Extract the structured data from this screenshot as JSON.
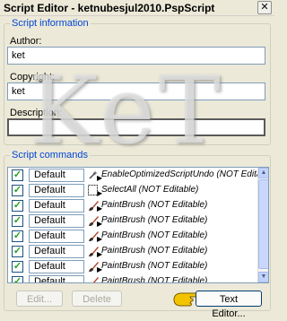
{
  "window": {
    "title": "Script Editor - ketnubesjul2010.PspScript",
    "close_glyph": "✕"
  },
  "script_info": {
    "legend": "Script information",
    "author_label": "Author:",
    "author_value": "ket",
    "copyright_label": "Copyright:",
    "copyright_value": "ket",
    "description_label": "Description:",
    "description_value": ""
  },
  "watermark": "KeT",
  "commands": {
    "legend": "Script commands",
    "rows": [
      {
        "checked": true,
        "mode": "Default",
        "icon": "optimize-icon",
        "text": "EnableOptimizedScriptUndo (NOT Editable)"
      },
      {
        "checked": true,
        "mode": "Default",
        "icon": "select-icon",
        "text": "SelectAll (NOT Editable)"
      },
      {
        "checked": true,
        "mode": "Default",
        "icon": "paintbrush-icon",
        "text": "PaintBrush (NOT Editable)"
      },
      {
        "checked": true,
        "mode": "Default",
        "icon": "paintbrush-icon",
        "text": "PaintBrush (NOT Editable)"
      },
      {
        "checked": true,
        "mode": "Default",
        "icon": "paintbrush-icon",
        "text": "PaintBrush (NOT Editable)"
      },
      {
        "checked": true,
        "mode": "Default",
        "icon": "paintbrush-icon",
        "text": "PaintBrush (NOT Editable)"
      },
      {
        "checked": true,
        "mode": "Default",
        "icon": "paintbrush-icon",
        "text": "PaintBrush (NOT Editable)"
      },
      {
        "checked": true,
        "mode": "Default",
        "icon": "paintbrush-icon",
        "text": "PaintBrush (NOT Editable)"
      }
    ]
  },
  "buttons": {
    "edit": "Edit...",
    "delete": "Delete",
    "text_editor": "Text Editor..."
  },
  "colors": {
    "legend": "#0046d5",
    "border": "#7f9db9",
    "check": "#21a121",
    "brush_handle": "#b2452a",
    "hand": "#f2c400"
  }
}
